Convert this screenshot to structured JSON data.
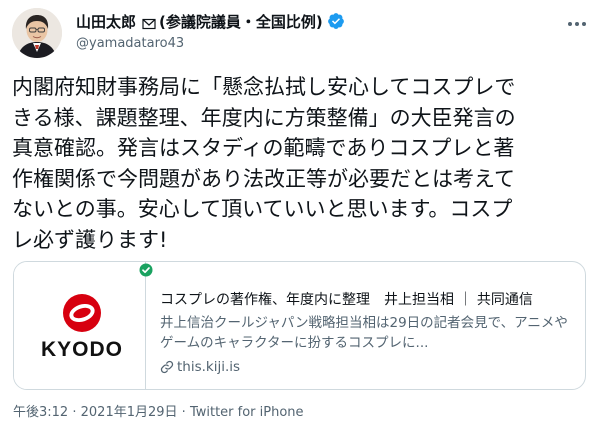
{
  "author": {
    "display_name": "山田太郎",
    "name_suffix": "(参議院議員・全国比例)",
    "handle": "@yamadataro43",
    "verified": true
  },
  "tweet": {
    "text": "内閣府知財事務局に「懸念払拭し安心してコスプレで\nきる様、課題整理、年度内に方策整備」の大臣発言の\n真意確認。発言はスタディの範疇でありコスプレと著\n作権関係で今問題があり法改正等が必要だとは考えて\nないとの事。安心して頂いていいと思います。コスプ\nレ必ず護ります!"
  },
  "card": {
    "logo_text": "KYODO",
    "title": "コスプレの著作権、年度内に整理　井上担当相 ｜ 共同通信",
    "description": "井上信治クールジャパン戦略担当相は29日の記者会見で、アニメやゲームのキャラクターに扮するコスプレに...",
    "domain": "this.kiji.is"
  },
  "meta": {
    "time": "午後3:12",
    "separator": "·",
    "date": "2021年1月29日",
    "source": "Twitter for iPhone"
  },
  "colors": {
    "text": "#0f1419",
    "secondary": "#536471",
    "verified": "#1d9bf0",
    "kyodo_red": "#d7000f",
    "card_border": "#cfd9de",
    "shield_green": "#1aa260"
  },
  "icons": {
    "verified": "verified-badge-icon",
    "mail": "envelope-icon",
    "more": "more-horizontal-icon",
    "link": "link-icon",
    "shield": "check-shield-icon"
  }
}
